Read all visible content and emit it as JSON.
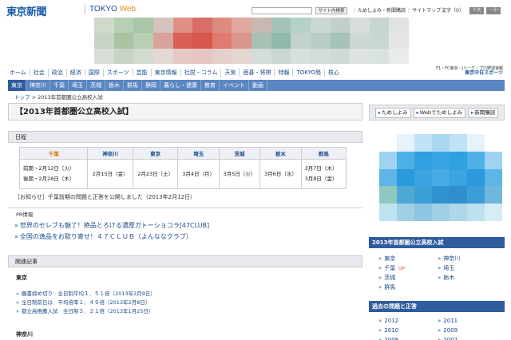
{
  "header": {
    "logo": "東京新聞",
    "logo_sub_a": "TOKYO",
    "logo_sub_b": "Web",
    "search_button": "サイト内検索",
    "links": [
      "ためしよみ・新聞購読",
      "サイトマップ"
    ],
    "font_size_label": "文字（0）",
    "font_plus": "＋大",
    "font_minus": "－小"
  },
  "global_nav": [
    "ホーム",
    "社会",
    "政治",
    "経済",
    "国際",
    "スポーツ",
    "芸能",
    "東京情報",
    "社説・コラム",
    "天気",
    "囲碁・将棋",
    "特報",
    "TOKYO発",
    "核心"
  ],
  "sports_banner": {
    "line1": "F1・FC東京・Jリーグ・プロ野球速報",
    "line2": "東京中日スポーツ"
  },
  "blue_nav": [
    "東京",
    "神奈川",
    "千葉",
    "埼玉",
    "茨城",
    "栃木",
    "群馬",
    "静岡",
    "暮らし・健康",
    "教育",
    "イベント",
    "動画"
  ],
  "breadcrumb": {
    "home": "トップ",
    "sep": " > ",
    "current": "2013年首都圏公立高校入試"
  },
  "page_title": "【2013年首都圏公立高校入試】",
  "schedule": {
    "heading": "日程",
    "columns": [
      "千葉",
      "神奈川",
      "東京",
      "埼玉",
      "茨城",
      "栃木",
      "群馬"
    ],
    "rows": [
      [
        "前期・2月12日（火）\n後期・2月28日（木）",
        "2月15日（金）",
        "2月23日（土）",
        "3月4日（月）",
        "3月5日（火）",
        "3月6日（水）",
        "3月7日（木）\n3月8日（金）"
      ]
    ]
  },
  "notice": "［お知らせ］千葉前期の問題と正答を公開しました（2013年2月12日）",
  "pr": {
    "label": "PR情報",
    "items": [
      "世界のセレブも魅了！絶品とろける濃厚ガトーショコラ[47CLUB]",
      "全国の逸品をお取り寄せ！４７ＣＬＵＢ（よんななクラブ）"
    ]
  },
  "related": {
    "heading": "関連記事",
    "tokyo_label": "東京",
    "tokyo_items": [
      "願書締め切り　全日制平均１．５１倍（2013年2月9日）",
      "全日制前日は　平均倍率１．４９倍（2013年2月8日）",
      "都立高推薦入試　全日制３．２１倍（2013年1月25日）"
    ],
    "kanagawa_label": "神奈川"
  },
  "right": {
    "buttons": [
      "ためしよみ",
      "Webでためしよみ",
      "新聞購読"
    ],
    "section1": "2013年首都圏公立高校入試",
    "prefs": [
      "東京",
      "神奈川",
      "千葉",
      "埼玉",
      "茨城",
      "栃木",
      "群馬"
    ],
    "up_badge": "UP!",
    "section2": "過去の問題と正答",
    "years": [
      "2012",
      "2011",
      "2010",
      "2009",
      "2008",
      "2007"
    ]
  },
  "colors": {
    "brand_blue": "#1a5ca8",
    "nav_blue": "#5a86c2",
    "accent_orange": "#e07800"
  }
}
